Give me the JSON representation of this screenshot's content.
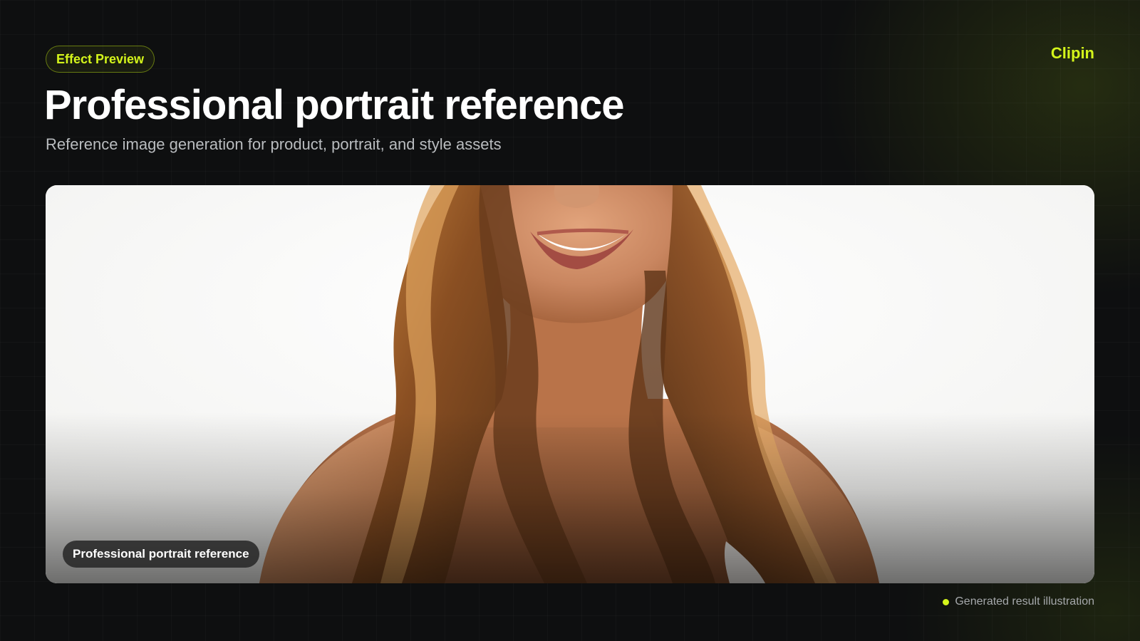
{
  "header": {
    "badge_label": "Effect Preview",
    "brand": "Clipin",
    "title": "Professional portrait reference",
    "subtitle": "Reference image generation for product, portrait, and style assets"
  },
  "preview": {
    "caption": "Professional portrait reference"
  },
  "footer": {
    "note": "Generated result illustration"
  },
  "colors": {
    "accent": "#d4f51b",
    "background": "#0e0f10"
  },
  "icons": {
    "status": "dot-icon"
  }
}
